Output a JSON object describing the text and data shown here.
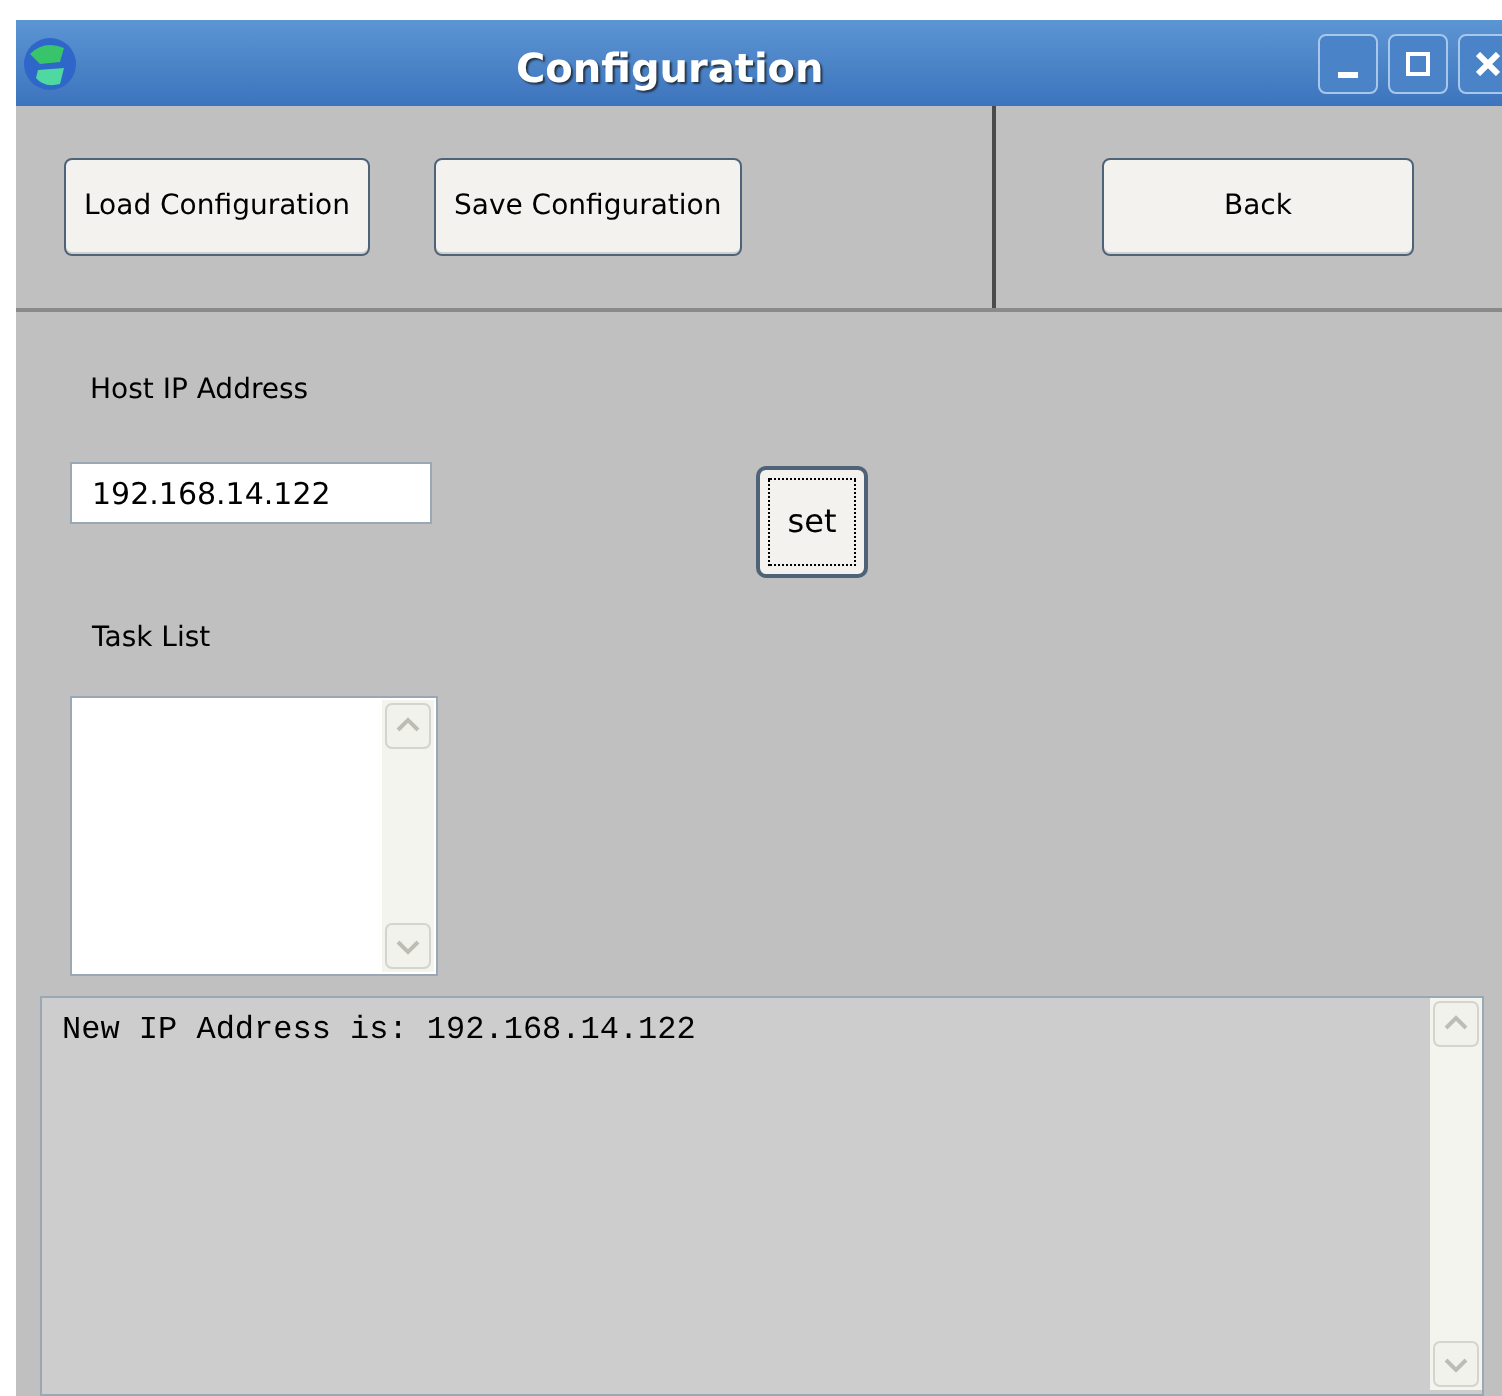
{
  "window": {
    "title": "Configuration"
  },
  "toolbar": {
    "left_buttons": [
      "Load Configuration",
      "Save Configuration"
    ],
    "right_button": "Back"
  },
  "host": {
    "label": "Host IP Address",
    "value": "192.168.14.122",
    "set_button": {
      "label": "set",
      "focused": true
    }
  },
  "task_list": {
    "label": "Task List"
  },
  "log": {
    "lines": [
      "New IP Address is: 192.168.14.122"
    ]
  }
}
